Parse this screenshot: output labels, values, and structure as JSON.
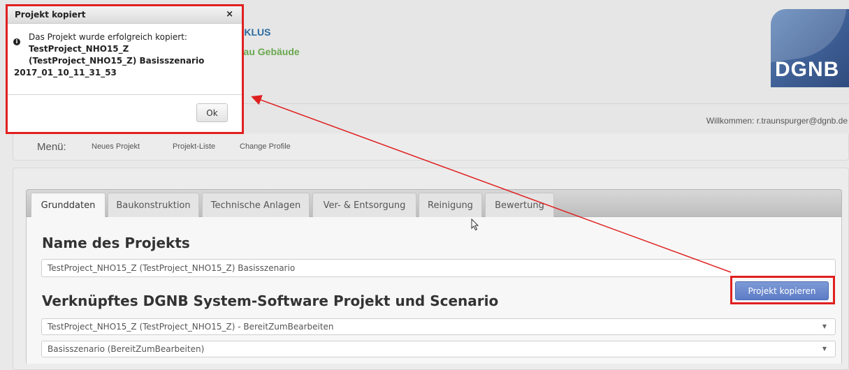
{
  "header": {
    "title_line1": "YKLUS",
    "title_line2": "bau Gebäude",
    "logo_text": "DGNB",
    "welcome": "Willkommen: r.traunspurger@dgnb.de"
  },
  "menu": {
    "label": "Menü:",
    "items": [
      "Neues Projekt",
      "Projekt-Liste",
      "Change Profile"
    ]
  },
  "tabs": [
    {
      "label": "Grunddaten",
      "active": true
    },
    {
      "label": "Baukonstruktion",
      "active": false
    },
    {
      "label": "Technische Anlagen",
      "active": false
    },
    {
      "label": "Ver- & Entsorgung",
      "active": false
    },
    {
      "label": "Reinigung",
      "active": false
    },
    {
      "label": "Bewertung",
      "active": false
    }
  ],
  "project": {
    "name_heading": "Name des Projekts",
    "name_value": "TestProject_NHO15_Z  (TestProject_NHO15_Z) Basisszenario",
    "copy_button": "Projekt kopieren",
    "linked_heading": "Verknüpftes DGNB System-Software Projekt und Scenario",
    "linked_project": "TestProject_NHO15_Z (TestProject_NHO15_Z) - BereitZumBearbeiten",
    "linked_scenario": "Basisszenario (BereitZumBearbeiten)"
  },
  "dialog": {
    "title": "Projekt kopiert",
    "close": "×",
    "info_icon": "i",
    "message_line1": "Das Projekt wurde erfolgreich kopiert:",
    "message_line2": "TestProject_NHO15_Z",
    "message_line3": "(TestProject_NHO15_Z) Basisszenario",
    "message_line4": "2017_01_10_11_31_53",
    "ok": "Ok"
  },
  "annotation_color": "#e02020",
  "icons": [
    "info-icon",
    "close-icon",
    "chevron-down-icon",
    "mouse-cursor-icon",
    "annotation-arrow"
  ]
}
